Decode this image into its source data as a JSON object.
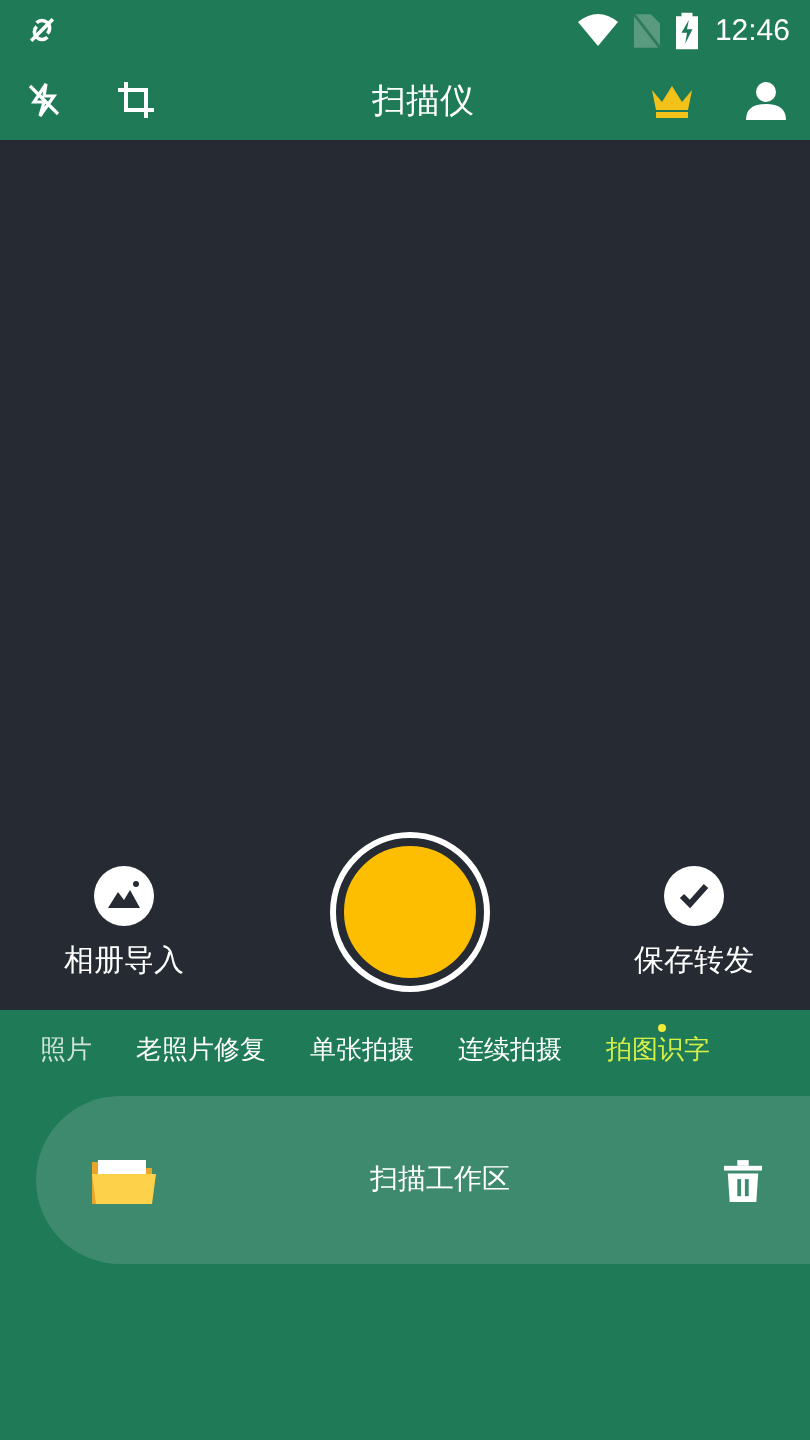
{
  "status_bar": {
    "time": "12:46"
  },
  "toolbar": {
    "title": "扫描仪"
  },
  "camera": {
    "left_action": "相册导入",
    "right_action": "保存转发"
  },
  "modes": [
    {
      "label": "照片",
      "selected": false
    },
    {
      "label": "老照片修复",
      "selected": false
    },
    {
      "label": "单张拍摄",
      "selected": false
    },
    {
      "label": "连续拍摄",
      "selected": false
    },
    {
      "label": "拍图识字",
      "selected": true
    }
  ],
  "workspace": {
    "label": "扫描工作区"
  }
}
